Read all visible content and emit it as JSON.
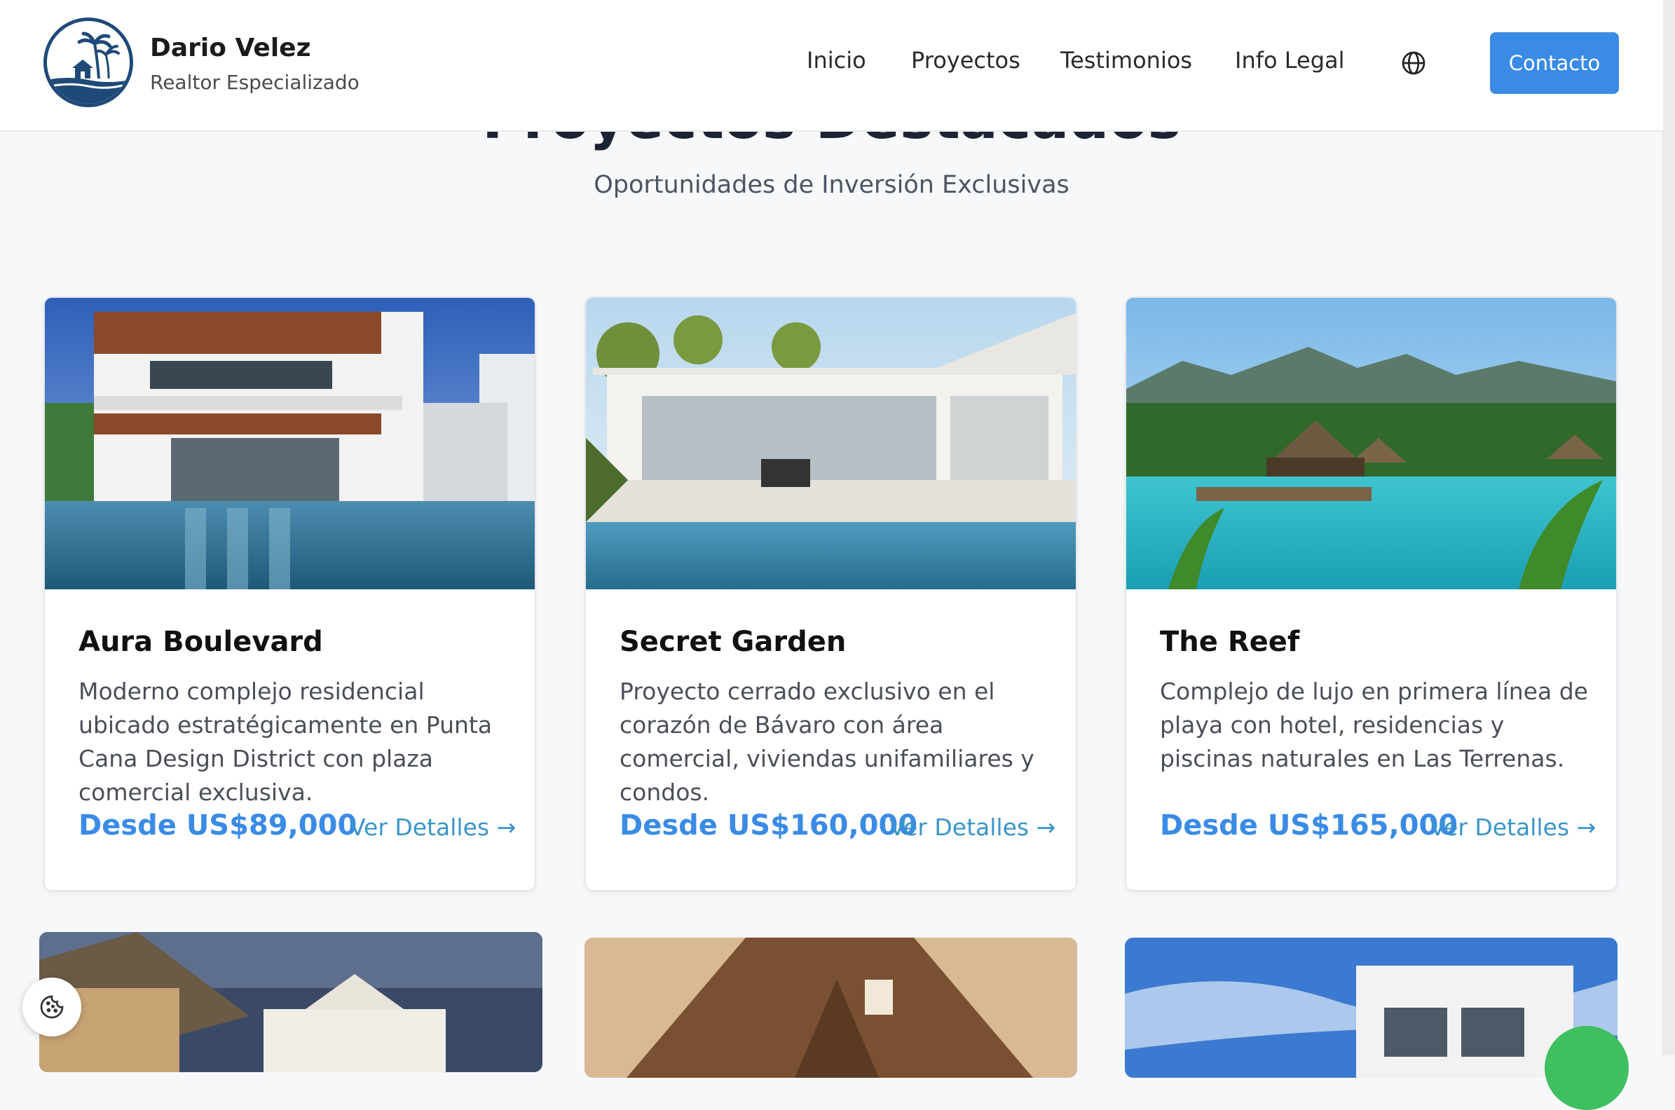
{
  "header": {
    "brand_name": "Dario Velez",
    "brand_sub": "Realtor Especializado",
    "nav": [
      "Inicio",
      "Proyectos",
      "Testimonios",
      "Info Legal"
    ],
    "contact_label": "Contacto"
  },
  "section": {
    "title": "Proyectos Destacados",
    "subtitle": "Oportunidades de Inversión Exclusivas"
  },
  "projects": [
    {
      "title": "Aura Boulevard",
      "description": "Moderno complejo residencial ubicado estratégicamente en Punta Cana Design District con plaza comercial exclusiva.",
      "price": "Desde US$89,000",
      "link": "Ver Detalles"
    },
    {
      "title": "Secret Garden",
      "description": "Proyecto cerrado exclusivo en el corazón de Bávaro con área comercial, viviendas unifamiliares y condos.",
      "price": "Desde US$160,000",
      "link": "Ver Detalles"
    },
    {
      "title": "The Reef",
      "description": "Complejo de lujo en primera línea de playa con hotel, residencias y piscinas naturales en Las Terrenas.",
      "price": "Desde US$165,000",
      "link": "Ver Detalles"
    }
  ],
  "icons": {
    "language": "globe-icon",
    "cookie": "cookie-icon",
    "arrow": "arrow-right-icon"
  },
  "colors": {
    "accent": "#3a8be6",
    "link": "#3a95c8",
    "logo": "#1f4a78"
  }
}
